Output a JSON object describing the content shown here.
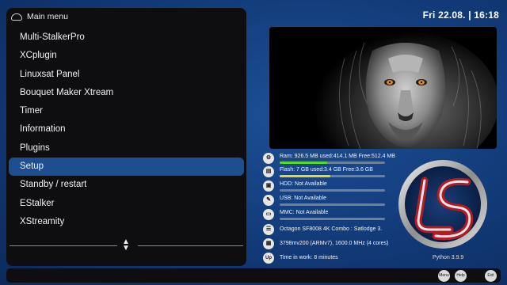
{
  "menu": {
    "title": "Main menu",
    "items": [
      {
        "label": "Multi-StalkerPro"
      },
      {
        "label": "XCplugin"
      },
      {
        "label": "Linuxsat Panel"
      },
      {
        "label": "Bouquet Maker Xtream"
      },
      {
        "label": "Timer"
      },
      {
        "label": "Information"
      },
      {
        "label": "Plugins"
      },
      {
        "label": "Setup"
      },
      {
        "label": "Standby / restart"
      },
      {
        "label": "EStalker"
      },
      {
        "label": "XStreamity"
      }
    ],
    "selected_index": 7
  },
  "clock": "Fri 22.08. | 16:18",
  "system_info": {
    "ram": {
      "text": "Ram: 926.5 MB used:414.1 MB Free:512.4 MB",
      "usage": 0.45,
      "color": "#55dd22"
    },
    "flash": {
      "text": "Flash: 7 GB used:3.4 GB Free:3.6 GB",
      "usage": 0.48,
      "color": "#e8d820"
    },
    "hdd": {
      "text": "HDD: Not Available"
    },
    "usb": {
      "text": "USB: Not Available"
    },
    "mmc": {
      "text": "MMC: Not Available"
    },
    "model": {
      "text": "Octagon SF8008 4K Combo : Satlodge 3."
    },
    "cpu": {
      "text": "3798mv200 (ARMv7), 1600.0 MHz (4 cores)"
    },
    "uptime": {
      "text": "Time in work: 8 minutes",
      "icon_label": "Up"
    }
  },
  "python_version": "Python 3.9.9",
  "buttons": {
    "menu": "Menu",
    "help": "Help",
    "exit": "Exit"
  },
  "icons": {
    "menu_logo": "remote-icon",
    "ram": "chip-icon",
    "flash": "flash-icon",
    "hdd": "hdd-icon",
    "usb": "usb-icon",
    "mmc": "mmc-icon",
    "model": "receiver-icon",
    "cpu": "cpu-icon",
    "scroll": "updown-arrows-icon"
  },
  "colors": {
    "selected": "#1e4e8f",
    "background": "#123a78"
  }
}
